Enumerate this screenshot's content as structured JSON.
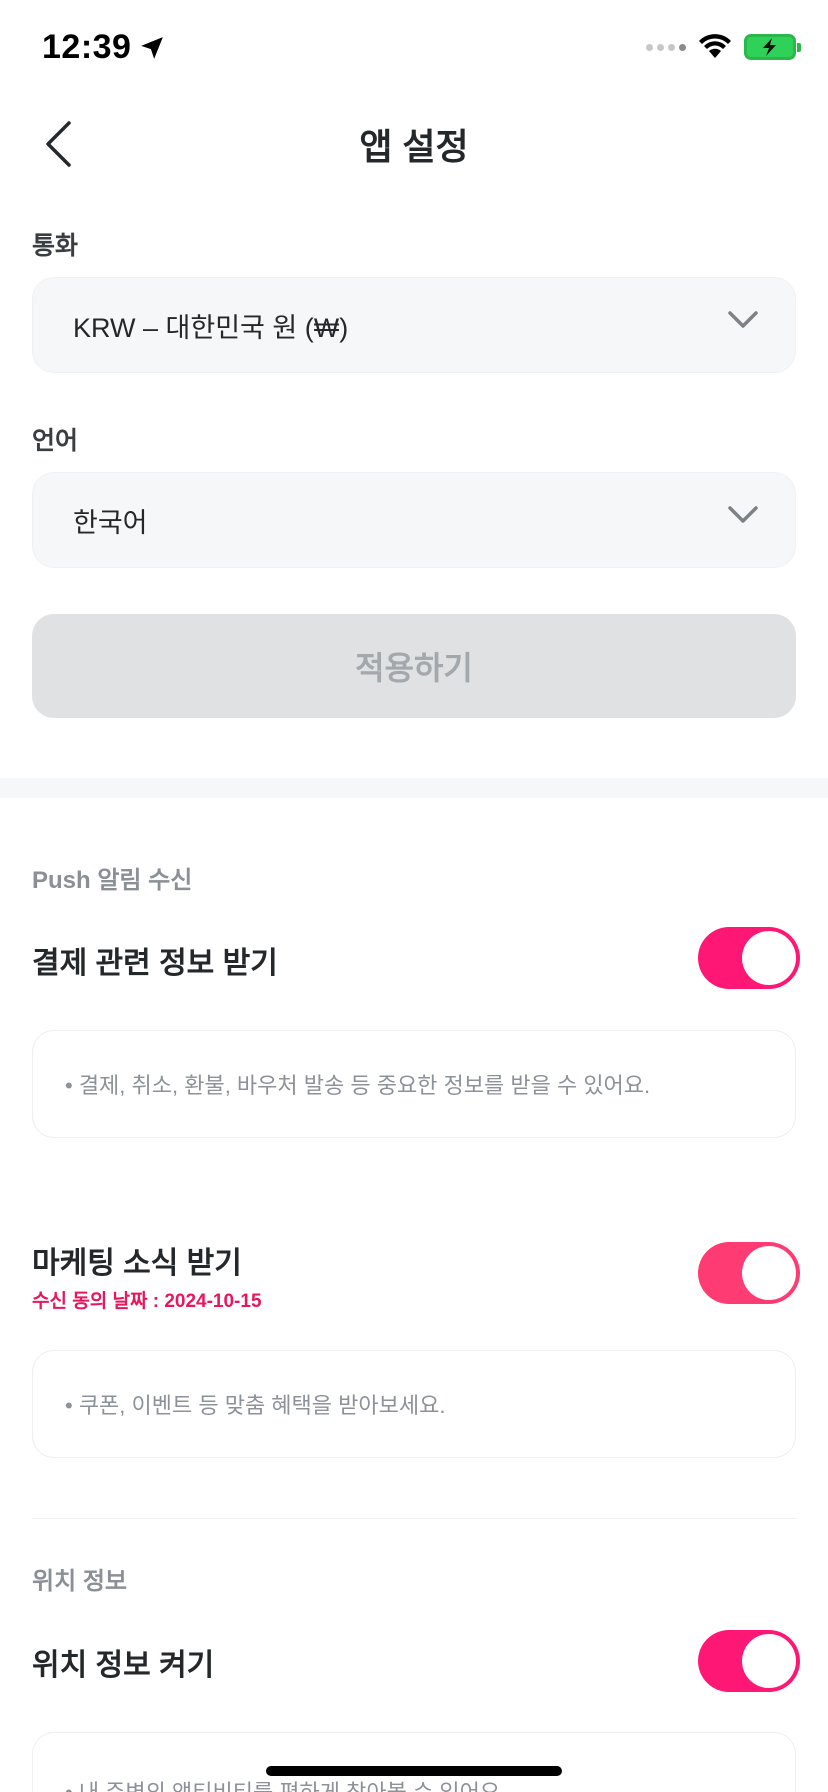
{
  "status_bar": {
    "time": "12:39",
    "battery_color": "#2fd158",
    "icons": [
      "location-arrow-icon",
      "signal-icon",
      "wifi-icon",
      "battery-charging-icon"
    ]
  },
  "nav": {
    "title": "앱 설정",
    "back_icon": "chevron-left-icon"
  },
  "currency": {
    "label": "통화",
    "value": "KRW – 대한민국 원 (₩)"
  },
  "language": {
    "label": "언어",
    "value": "한국어"
  },
  "apply_button": {
    "label": "적용하기",
    "enabled": false
  },
  "push": {
    "section_title": "Push 알림 수신",
    "payment": {
      "title": "결제 관련 정보 받기",
      "enabled": true,
      "description": "• 결제, 취소, 환불, 바우처 발송 등 중요한 정보를 받을 수 있어요."
    },
    "marketing": {
      "title": "마케팅 소식 받기",
      "consent_date": "수신 동의 날짜 : 2024-10-15",
      "enabled": true,
      "description": "• 쿠폰, 이벤트 등 맞춤 혜택을 받아보세요."
    }
  },
  "location": {
    "section_title": "위치 정보",
    "toggle_title": "위치 정보 켜기",
    "enabled": true,
    "description": "• 내 주변의 액티비티를 편하게 찾아볼 수 있어요."
  },
  "colors": {
    "accent": "#ff1775",
    "accent_alt": "#ff3b73",
    "consent_text": "#e8155f",
    "disabled_button": "#dfe1e3"
  }
}
